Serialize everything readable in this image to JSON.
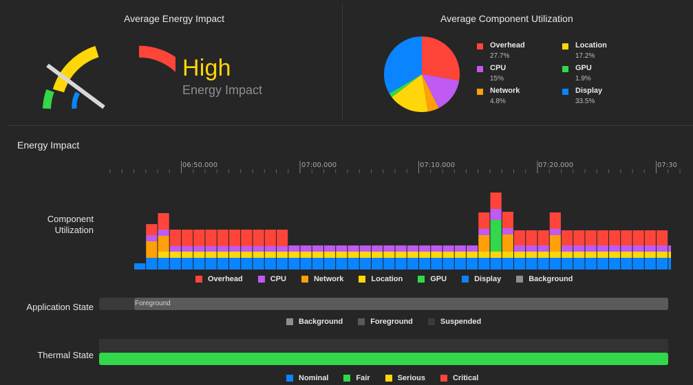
{
  "energy": {
    "title": "Average Energy Impact",
    "level": "High",
    "level_caption": "Energy Impact"
  },
  "components": {
    "title": "Average Component Utilization",
    "items": [
      {
        "name": "Overhead",
        "value": "27.7%",
        "color": "#ff453a",
        "pct": 27.7
      },
      {
        "name": "Location",
        "value": "17.2%",
        "color": "#ffd60a",
        "pct": 17.2
      },
      {
        "name": "CPU",
        "value": "15%",
        "color": "#bf5af2",
        "pct": 15.0
      },
      {
        "name": "GPU",
        "value": "1.9%",
        "color": "#32d74b",
        "pct": 1.9
      },
      {
        "name": "Network",
        "value": "4.8%",
        "color": "#ff9f0a",
        "pct": 4.8
      },
      {
        "name": "Display",
        "value": "33.5%",
        "color": "#0a84ff",
        "pct": 33.5
      }
    ]
  },
  "timeline": {
    "title": "Energy Impact",
    "ticks": [
      "06:50.000",
      "07:00.000",
      "07:10.000",
      "07:20.000",
      "07:30"
    ]
  },
  "component_utilization": {
    "label": "Component Utilization",
    "legend": [
      {
        "name": "Overhead",
        "color": "#ff453a"
      },
      {
        "name": "CPU",
        "color": "#bf5af2"
      },
      {
        "name": "Network",
        "color": "#ff9f0a"
      },
      {
        "name": "Location",
        "color": "#ffd60a"
      },
      {
        "name": "GPU",
        "color": "#32d74b"
      },
      {
        "name": "Display",
        "color": "#0a84ff"
      },
      {
        "name": "Background",
        "color": "#8e8e8e"
      }
    ]
  },
  "chart_data": {
    "type": "bar",
    "stacked": true,
    "series_order": [
      "Display",
      "Location",
      "GPU",
      "Network",
      "CPU",
      "Overhead"
    ],
    "bars": [
      {
        "Display": 9,
        "Location": 0,
        "GPU": 0,
        "Network": 0,
        "CPU": 0,
        "Overhead": 0
      },
      {
        "Display": 17,
        "Location": 0,
        "GPU": 0,
        "Network": 24,
        "CPU": 9,
        "Overhead": 16
      },
      {
        "Display": 17,
        "Location": 9,
        "GPU": 0,
        "Network": 23,
        "CPU": 9,
        "Overhead": 24
      },
      {
        "Display": 17,
        "Location": 9,
        "GPU": 0,
        "Network": 0,
        "CPU": 8,
        "Overhead": 24
      },
      {
        "Display": 17,
        "Location": 9,
        "GPU": 0,
        "Network": 0,
        "CPU": 8,
        "Overhead": 24
      },
      {
        "Display": 17,
        "Location": 9,
        "GPU": 0,
        "Network": 0,
        "CPU": 8,
        "Overhead": 24
      },
      {
        "Display": 17,
        "Location": 9,
        "GPU": 0,
        "Network": 0,
        "CPU": 8,
        "Overhead": 24
      },
      {
        "Display": 17,
        "Location": 9,
        "GPU": 0,
        "Network": 0,
        "CPU": 8,
        "Overhead": 24
      },
      {
        "Display": 17,
        "Location": 9,
        "GPU": 0,
        "Network": 0,
        "CPU": 8,
        "Overhead": 24
      },
      {
        "Display": 17,
        "Location": 9,
        "GPU": 0,
        "Network": 0,
        "CPU": 8,
        "Overhead": 24
      },
      {
        "Display": 17,
        "Location": 9,
        "GPU": 0,
        "Network": 0,
        "CPU": 8,
        "Overhead": 24
      },
      {
        "Display": 17,
        "Location": 9,
        "GPU": 0,
        "Network": 0,
        "CPU": 8,
        "Overhead": 24
      },
      {
        "Display": 17,
        "Location": 9,
        "GPU": 0,
        "Network": 0,
        "CPU": 8,
        "Overhead": 24
      },
      {
        "Display": 17,
        "Location": 9,
        "GPU": 0,
        "Network": 0,
        "CPU": 9,
        "Overhead": 0
      },
      {
        "Display": 17,
        "Location": 9,
        "GPU": 0,
        "Network": 0,
        "CPU": 9,
        "Overhead": 0
      },
      {
        "Display": 17,
        "Location": 9,
        "GPU": 0,
        "Network": 0,
        "CPU": 9,
        "Overhead": 0
      },
      {
        "Display": 17,
        "Location": 9,
        "GPU": 0,
        "Network": 0,
        "CPU": 9,
        "Overhead": 0
      },
      {
        "Display": 17,
        "Location": 9,
        "GPU": 0,
        "Network": 0,
        "CPU": 9,
        "Overhead": 0
      },
      {
        "Display": 17,
        "Location": 9,
        "GPU": 0,
        "Network": 0,
        "CPU": 9,
        "Overhead": 0
      },
      {
        "Display": 17,
        "Location": 9,
        "GPU": 0,
        "Network": 0,
        "CPU": 9,
        "Overhead": 0
      },
      {
        "Display": 17,
        "Location": 9,
        "GPU": 0,
        "Network": 0,
        "CPU": 9,
        "Overhead": 0
      },
      {
        "Display": 17,
        "Location": 9,
        "GPU": 0,
        "Network": 0,
        "CPU": 9,
        "Overhead": 0
      },
      {
        "Display": 17,
        "Location": 9,
        "GPU": 0,
        "Network": 0,
        "CPU": 9,
        "Overhead": 0
      },
      {
        "Display": 17,
        "Location": 9,
        "GPU": 0,
        "Network": 0,
        "CPU": 9,
        "Overhead": 0
      },
      {
        "Display": 17,
        "Location": 9,
        "GPU": 0,
        "Network": 0,
        "CPU": 9,
        "Overhead": 0
      },
      {
        "Display": 17,
        "Location": 9,
        "GPU": 0,
        "Network": 0,
        "CPU": 9,
        "Overhead": 0
      },
      {
        "Display": 17,
        "Location": 9,
        "GPU": 0,
        "Network": 0,
        "CPU": 9,
        "Overhead": 0
      },
      {
        "Display": 17,
        "Location": 9,
        "GPU": 0,
        "Network": 0,
        "CPU": 9,
        "Overhead": 0
      },
      {
        "Display": 17,
        "Location": 9,
        "GPU": 0,
        "Network": 0,
        "CPU": 9,
        "Overhead": 0
      },
      {
        "Display": 17,
        "Location": 9,
        "GPU": 0,
        "Network": 24,
        "CPU": 9,
        "Overhead": 24
      },
      {
        "Display": 17,
        "Location": 9,
        "GPU": 46,
        "Network": 0,
        "CPU": 16,
        "Overhead": 24
      },
      {
        "Display": 17,
        "Location": 9,
        "GPU": 0,
        "Network": 25,
        "CPU": 9,
        "Overhead": 24
      },
      {
        "Display": 17,
        "Location": 9,
        "GPU": 0,
        "Network": 0,
        "CPU": 9,
        "Overhead": 22
      },
      {
        "Display": 17,
        "Location": 9,
        "GPU": 0,
        "Network": 0,
        "CPU": 9,
        "Overhead": 22
      },
      {
        "Display": 17,
        "Location": 9,
        "GPU": 0,
        "Network": 0,
        "CPU": 9,
        "Overhead": 22
      },
      {
        "Display": 17,
        "Location": 9,
        "GPU": 0,
        "Network": 24,
        "CPU": 9,
        "Overhead": 24
      },
      {
        "Display": 17,
        "Location": 9,
        "GPU": 0,
        "Network": 0,
        "CPU": 9,
        "Overhead": 22
      },
      {
        "Display": 17,
        "Location": 9,
        "GPU": 0,
        "Network": 0,
        "CPU": 9,
        "Overhead": 22
      },
      {
        "Display": 17,
        "Location": 9,
        "GPU": 0,
        "Network": 0,
        "CPU": 9,
        "Overhead": 22
      },
      {
        "Display": 17,
        "Location": 9,
        "GPU": 0,
        "Network": 0,
        "CPU": 9,
        "Overhead": 22
      },
      {
        "Display": 17,
        "Location": 9,
        "GPU": 0,
        "Network": 0,
        "CPU": 9,
        "Overhead": 22
      },
      {
        "Display": 17,
        "Location": 9,
        "GPU": 0,
        "Network": 0,
        "CPU": 9,
        "Overhead": 22
      },
      {
        "Display": 17,
        "Location": 9,
        "GPU": 0,
        "Network": 0,
        "CPU": 9,
        "Overhead": 22
      },
      {
        "Display": 17,
        "Location": 9,
        "GPU": 0,
        "Network": 0,
        "CPU": 9,
        "Overhead": 22
      },
      {
        "Display": 17,
        "Location": 9,
        "GPU": 0,
        "Network": 0,
        "CPU": 9,
        "Overhead": 22
      },
      {
        "Display": 17,
        "Location": 9,
        "GPU": 0,
        "Network": 0,
        "CPU": 9,
        "Overhead": 0
      },
      {
        "Display": 17,
        "Location": 9,
        "GPU": 0,
        "Network": 0,
        "CPU": 9,
        "Overhead": 0
      }
    ]
  },
  "application_state": {
    "label": "Application State",
    "segment_label": "Foreground",
    "legend": [
      {
        "name": "Background",
        "color": "#8e8e8e"
      },
      {
        "name": "Foreground",
        "color": "#5a5a5a"
      },
      {
        "name": "Suspended",
        "color": "#3a3a3a"
      }
    ]
  },
  "thermal_state": {
    "label": "Thermal State",
    "legend": [
      {
        "name": "Nominal",
        "color": "#0a84ff"
      },
      {
        "name": "Fair",
        "color": "#32d74b"
      },
      {
        "name": "Serious",
        "color": "#ffd60a"
      },
      {
        "name": "Critical",
        "color": "#ff453a"
      }
    ]
  }
}
